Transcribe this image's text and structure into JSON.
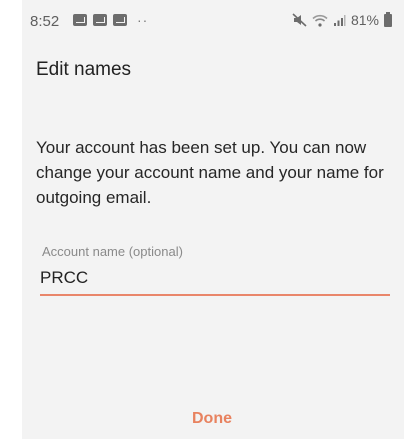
{
  "status_bar": {
    "time": "8:52",
    "more": "··",
    "battery": "81%"
  },
  "page": {
    "title": "Edit names",
    "intro": "Your account has been set up. You can now change your account name and your name for outgoing email."
  },
  "account_name_field": {
    "label": "Account name (optional)",
    "value": "PRCC"
  },
  "actions": {
    "done_label": "Done"
  },
  "colors": {
    "accent": "#e8825f",
    "background": "#f3f3f3"
  }
}
